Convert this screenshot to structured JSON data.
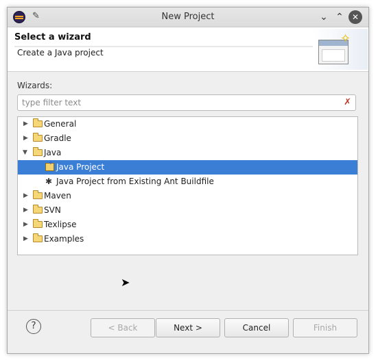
{
  "window": {
    "title": "New Project"
  },
  "header": {
    "title": "Select a wizard",
    "description": "Create a Java project"
  },
  "wizards": {
    "label": "Wizards:",
    "filter_placeholder": "type filter text",
    "filter_value": ""
  },
  "tree": {
    "items": [
      {
        "label": "General",
        "type": "folder",
        "expanded": false
      },
      {
        "label": "Gradle",
        "type": "folder",
        "expanded": false
      },
      {
        "label": "Java",
        "type": "folder",
        "expanded": true
      },
      {
        "label": "Java Project",
        "type": "java-project",
        "selected": true
      },
      {
        "label": "Java Project from Existing Ant Buildfile",
        "type": "ant"
      },
      {
        "label": "Maven",
        "type": "folder",
        "expanded": false
      },
      {
        "label": "SVN",
        "type": "folder",
        "expanded": false
      },
      {
        "label": "Texlipse",
        "type": "folder",
        "expanded": false
      },
      {
        "label": "Examples",
        "type": "folder",
        "expanded": false
      }
    ]
  },
  "buttons": {
    "back": "< Back",
    "next": "Next >",
    "cancel": "Cancel",
    "finish": "Finish",
    "help": "?"
  },
  "colors": {
    "selection": "#3b7ed6",
    "dialog_bg": "#efefef"
  }
}
